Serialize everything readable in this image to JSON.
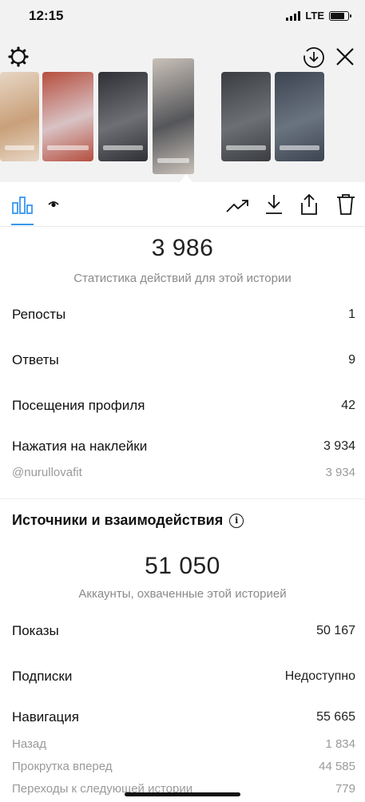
{
  "status_bar": {
    "time": "12:15",
    "network": "LTE",
    "battery_level": 0.8
  },
  "icons": {
    "settings": "gear-icon",
    "save": "download-circle-icon",
    "close": "close-icon",
    "insights_tab": "bar-chart-icon",
    "viewers_tab": "eye-icon",
    "promote": "trending-up-icon",
    "download": "download-icon",
    "share": "share-icon",
    "delete": "trash-icon"
  },
  "story_thumbnails": [
    {
      "bg": "#c9a07a",
      "accent": "#e7d6c4"
    },
    {
      "bg": "#d9c2c4",
      "accent": "#b64e3e"
    },
    {
      "bg": "#6e6f74",
      "accent": "#2f3035"
    },
    {
      "bg": "#55565a",
      "accent": "#c9c1b9",
      "active": true
    },
    {
      "bg": "#6c7075",
      "accent": "#3a3c40"
    },
    {
      "bg": "#6a7480",
      "accent": "#3c4451"
    }
  ],
  "actions": {
    "total": "3 986",
    "subtitle": "Статистика действий для этой истории",
    "rows": [
      {
        "label": "Репосты",
        "value": "1"
      },
      {
        "label": "Ответы",
        "value": "9"
      },
      {
        "label": "Посещения профиля",
        "value": "42"
      },
      {
        "label": "Нажатия на наклейки",
        "value": "3 934"
      }
    ],
    "sticker": {
      "label": "@nurullovafit",
      "value": "3 934"
    }
  },
  "discovery": {
    "heading": "Источники и взаимодействия",
    "info_icon": "i",
    "total": "51 050",
    "subtitle": "Аккаунты, охваченные этой историей",
    "rows": [
      {
        "label": "Показы",
        "value": "50 167"
      },
      {
        "label": "Подписки",
        "value": "Недоступно"
      },
      {
        "label": "Навигация",
        "value": "55 665"
      }
    ],
    "navigation": [
      {
        "label": "Назад",
        "value": "1 834"
      },
      {
        "label": "Прокрутка вперед",
        "value": "44 585"
      },
      {
        "label": "Переходы к следующей истории",
        "value": "779"
      }
    ]
  }
}
